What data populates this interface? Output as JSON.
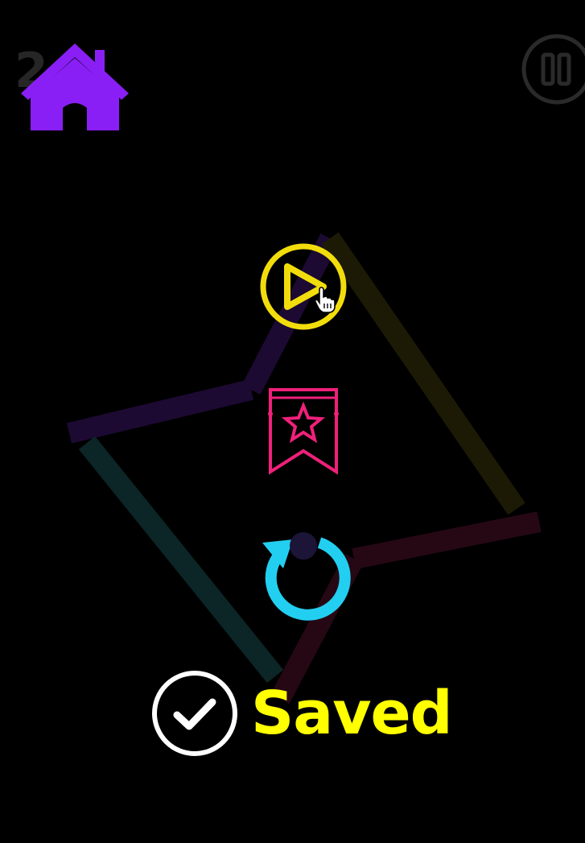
{
  "hud": {
    "score_value": "2"
  },
  "menu": {
    "home_icon": "home-icon",
    "pause_icon": "pause-icon",
    "play_icon": "play-icon",
    "bookmark_icon": "bookmark-star-icon",
    "restart_icon": "restart-icon"
  },
  "status": {
    "saved_label": "Saved",
    "check_icon": "checkmark-circle-icon"
  },
  "colors": {
    "background": "#000000",
    "home": "#8a1ff5",
    "play": "#f2dd0c",
    "bookmark": "#f0207a",
    "restart": "#22cff0",
    "saved_text": "#ffff00",
    "check": "#ffffff",
    "pause": "#2a2a2a"
  }
}
